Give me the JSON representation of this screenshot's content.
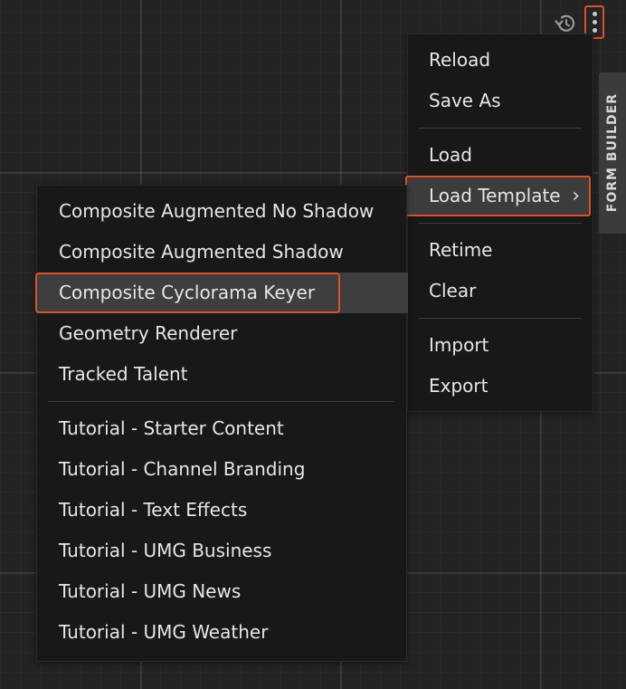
{
  "toolbar": {
    "history_icon": "history-icon",
    "more_icon": "vertical-ellipsis-icon",
    "accent_color": "#d9532a"
  },
  "side_tab": {
    "label": "FORM BUILDER"
  },
  "main_menu": {
    "groups": [
      [
        "Reload",
        "Save As"
      ],
      [
        "Load",
        "Load Template"
      ],
      [
        "Retime",
        "Clear"
      ],
      [
        "Import",
        "Export"
      ]
    ],
    "open_item": "Load Template"
  },
  "template_menu": {
    "groups": [
      [
        "Composite Augmented No Shadow",
        "Composite Augmented Shadow",
        "Composite Cyclorama Keyer",
        "Geometry Renderer",
        "Tracked Talent"
      ],
      [
        "Tutorial - Starter Content",
        "Tutorial - Channel Branding",
        "Tutorial - Text Effects",
        "Tutorial - UMG Business",
        "Tutorial - UMG News",
        "Tutorial - UMG Weather"
      ]
    ],
    "hovered_item": "Composite Cyclorama Keyer"
  }
}
